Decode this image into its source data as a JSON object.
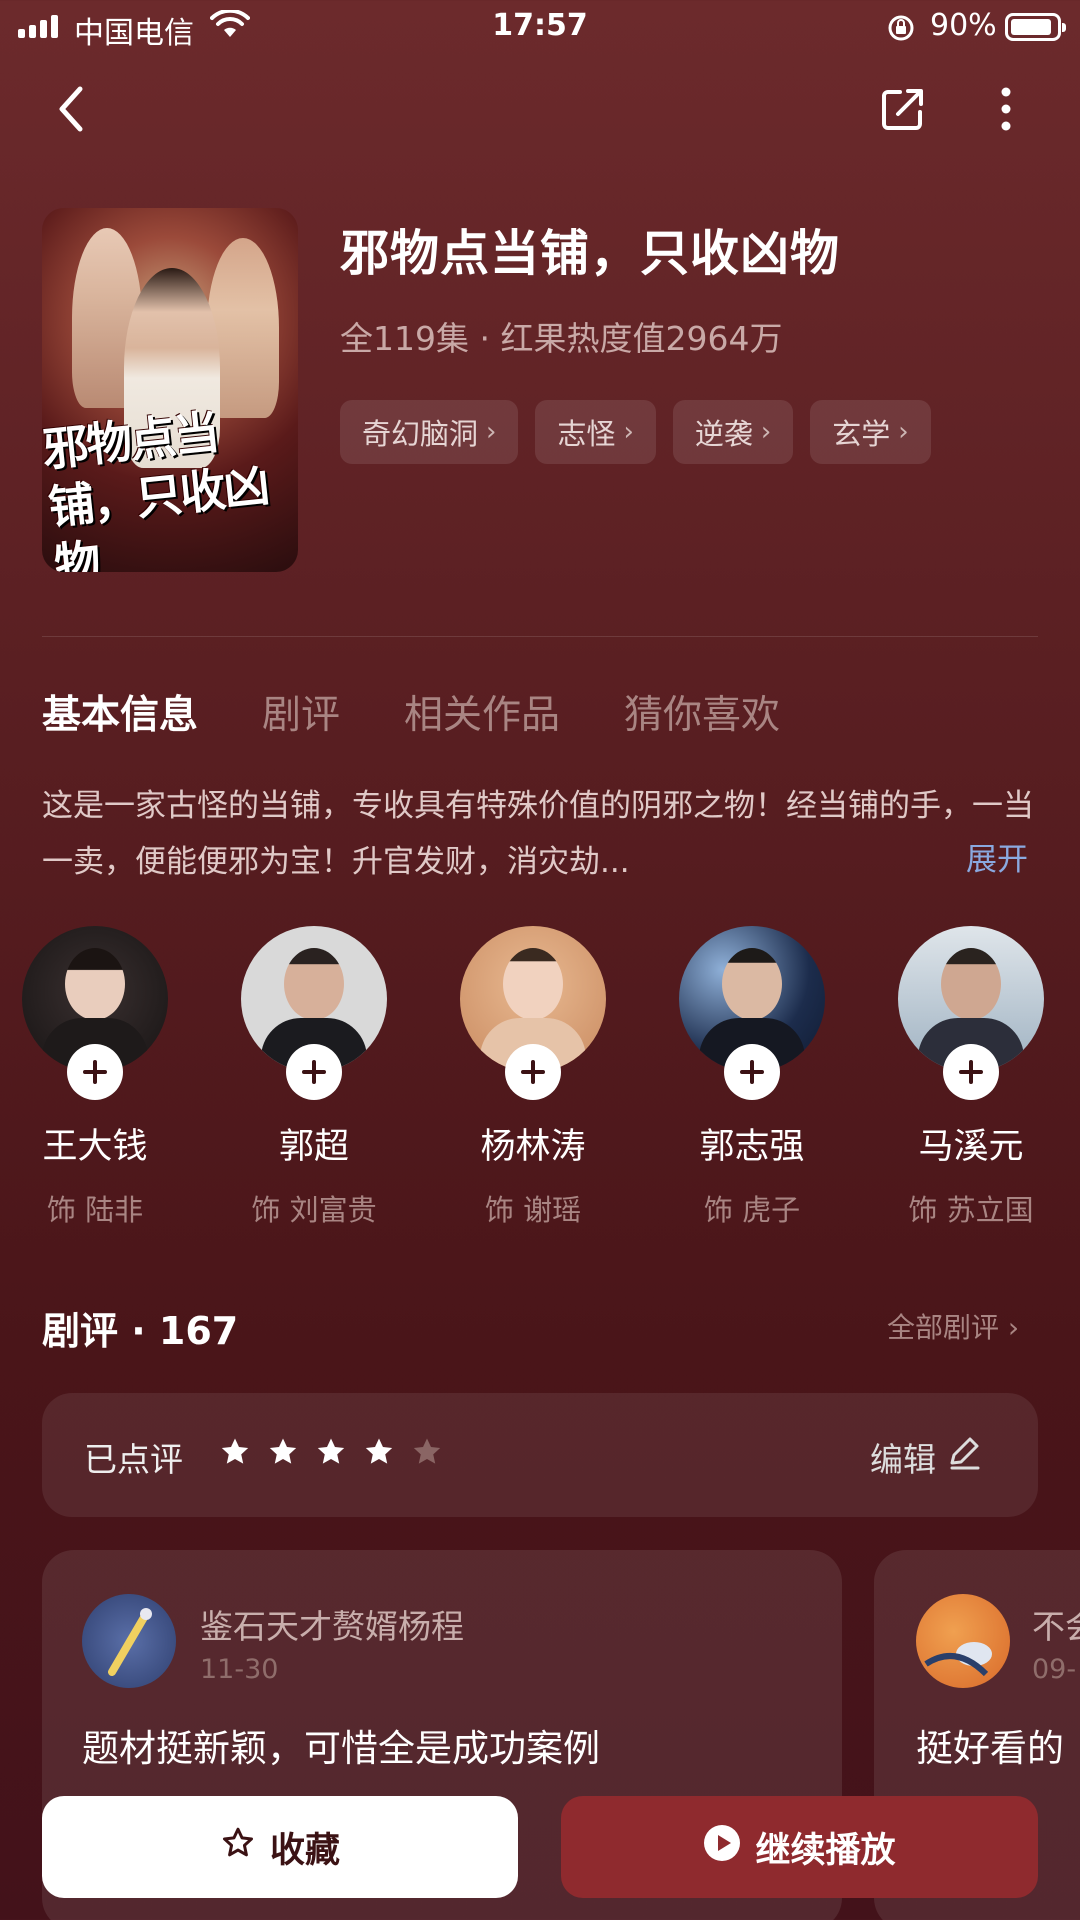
{
  "status": {
    "carrier": "中国电信",
    "time": "17:57",
    "battery": "90%"
  },
  "nav": {
    "back_icon": "chevron-left-icon",
    "share_icon": "share-icon",
    "more_icon": "more-vertical-icon"
  },
  "show": {
    "poster_text": "邪物点当铺，只收凶物",
    "title": "邪物点当铺，只收凶物",
    "meta": "全119集 · 红果热度值2964万",
    "tags": [
      "奇幻脑洞",
      "志怪",
      "逆袭",
      "玄学"
    ]
  },
  "tabs": [
    "基本信息",
    "剧评",
    "相关作品",
    "猜你喜欢"
  ],
  "active_tab": 0,
  "synopsis": "这是一家古怪的当铺，专收具有特殊价值的阴邪之物！经当铺的手，一当一卖，便能便邪为宝！升官发财，消灾劫...",
  "expand_label": "展开",
  "cast": [
    {
      "name": "王大钱",
      "role": "饰 陆非"
    },
    {
      "name": "郭超",
      "role": "饰 刘富贵"
    },
    {
      "name": "杨林涛",
      "role": "饰 谢瑶"
    },
    {
      "name": "郭志强",
      "role": "饰 虎子"
    },
    {
      "name": "马溪元",
      "role": "饰 苏立国"
    }
  ],
  "reviews": {
    "title": "剧评 · 167",
    "all_label": "全部剧评",
    "rated_label": "已点评",
    "rating": 4,
    "rating_max": 5,
    "edit_label": "编辑",
    "items": [
      {
        "user": "鉴石天才赘婿杨程",
        "date": "11-30",
        "text": "题材挺新颖，可惜全是成功案例"
      },
      {
        "user": "不会",
        "date": "09-",
        "text": "挺好看的"
      }
    ]
  },
  "actions": {
    "favorite_label": "收藏",
    "play_label": "继续播放"
  },
  "colors": {
    "accent_link": "#8aa9e0",
    "play_button": "#8f2a2e"
  }
}
